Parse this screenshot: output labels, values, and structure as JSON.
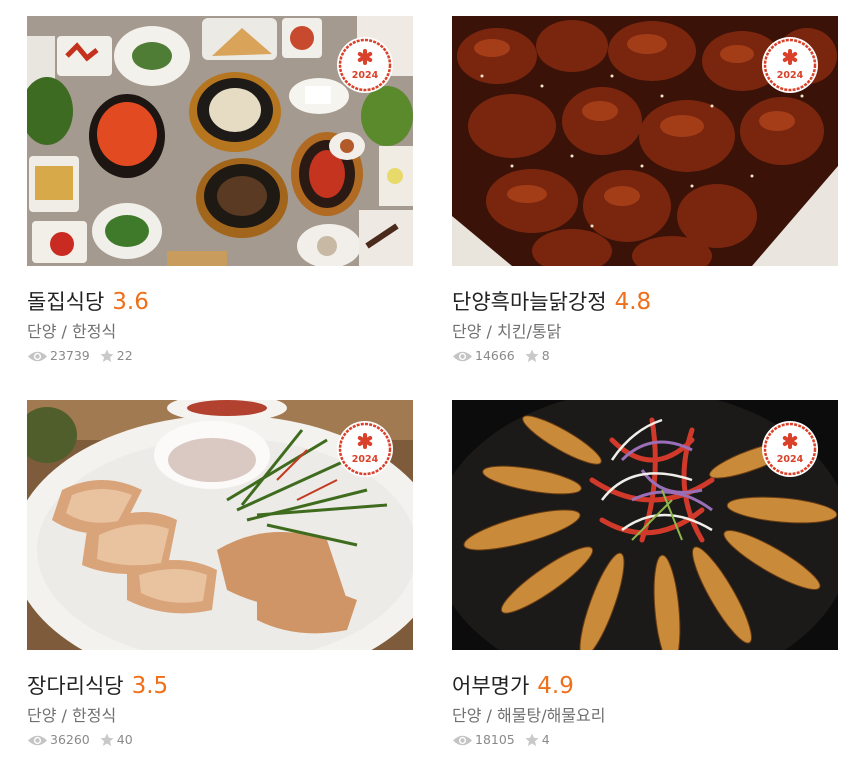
{
  "badge_year": "2024",
  "colors": {
    "score": "#ef6f1a",
    "badge_red": "#d9412a"
  },
  "restaurants": [
    {
      "name": "돌집식당",
      "rating": "3.6",
      "region": "단양",
      "separator": "/",
      "category": "한정식",
      "views": "23739",
      "likes": "22",
      "image": "korean-table-set"
    },
    {
      "name": "단양흑마늘닭강정",
      "rating": "4.8",
      "region": "단양",
      "separator": "/",
      "category": "치킨/통닭",
      "views": "14666",
      "likes": "8",
      "image": "glazed-fried-chicken"
    },
    {
      "name": "장다리식당",
      "rating": "3.5",
      "region": "단양",
      "separator": "/",
      "category": "한정식",
      "views": "36260",
      "likes": "40",
      "image": "sliced-boiled-pork"
    },
    {
      "name": "어부명가",
      "rating": "4.9",
      "region": "단양",
      "separator": "/",
      "category": "해물탕/해물요리",
      "views": "18105",
      "likes": "4",
      "image": "grilled-smelt-fish"
    }
  ]
}
